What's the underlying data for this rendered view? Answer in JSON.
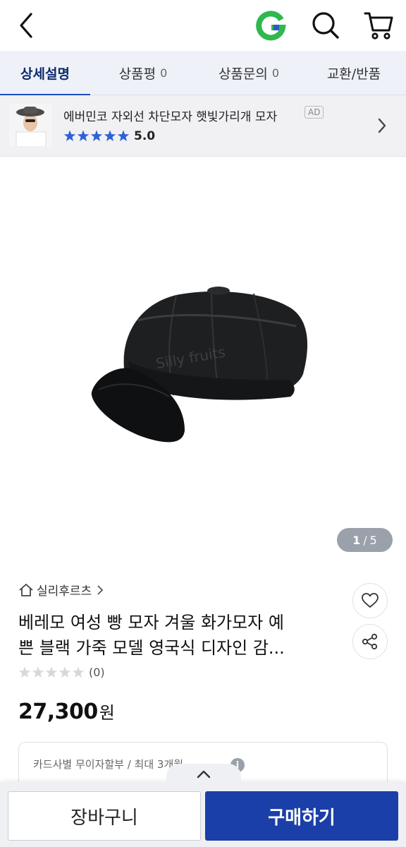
{
  "colors": {
    "accent": "#1d4fbe",
    "buy_button": "#1a3fa8",
    "tab_bar_bg": "#eef2f8",
    "star_blue": "#2f62d8",
    "star_empty": "#d6d8dc",
    "logo_green": "#2fb84d"
  },
  "header": {
    "icons": [
      "back-arrow-icon",
      "gmarket-g-logo",
      "search-icon",
      "cart-icon"
    ]
  },
  "tabs": [
    {
      "label": "상세설명",
      "count": "",
      "active": true
    },
    {
      "label": "상품평",
      "count": "0",
      "active": false
    },
    {
      "label": "상품문의",
      "count": "0",
      "active": false
    },
    {
      "label": "교환/반품",
      "count": "",
      "active": false
    }
  ],
  "ad_banner": {
    "title": "에버민코 자외선 차단모자 햇빛가리개 모자",
    "badge": "AD",
    "rating": "5.0",
    "stars_filled": 5
  },
  "product": {
    "pager_current": "1",
    "pager_sep": "/",
    "pager_total": "5",
    "watermark": "Silly fruits",
    "shop_name": "실리후르츠",
    "title_line1": "베레모 여성 빵 모자 겨울 화가모자 예",
    "title_line2": "쁜 블랙 가죽 모델 영국식 디자인 감...",
    "review_count": "(0)",
    "stars_filled": 0,
    "price": "27,300",
    "currency": "원",
    "installment_text": "카드사별 무이자할부 / 최대 3개월"
  },
  "bottom_bar": {
    "cart_label": "장바구니",
    "buy_label": "구매하기"
  }
}
